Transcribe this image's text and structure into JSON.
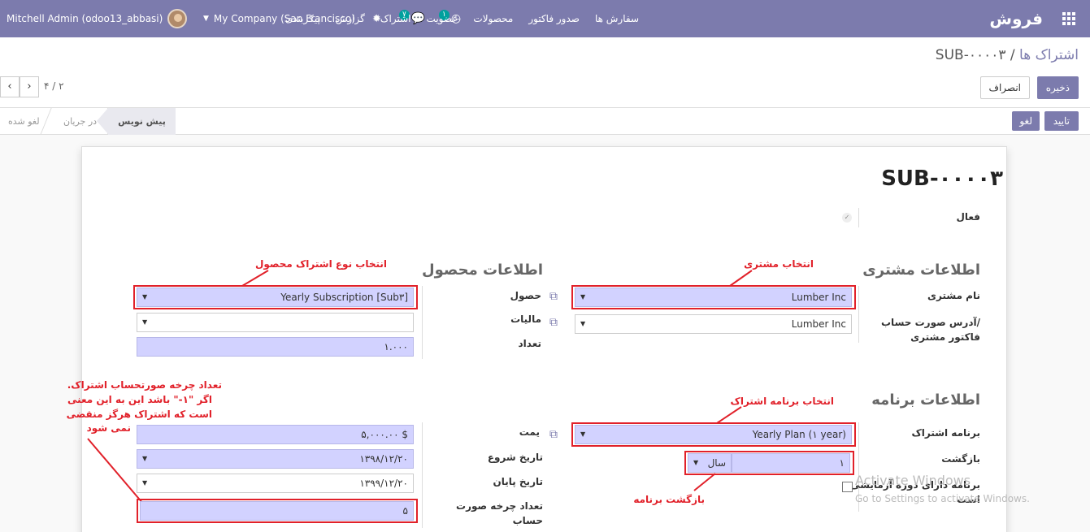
{
  "navbar": {
    "user": "Mitchell Admin (odoo13_abbasi)",
    "company": "My Company (San Francisco)",
    "chat_count": "۷",
    "activity_count": "۱",
    "brand": "فروش",
    "menu": [
      "سفارش ها",
      "صدور فاکتور",
      "محصولات",
      "عضویت",
      "اشتراک",
      "گزارش",
      "پیکربندی"
    ]
  },
  "breadcrumb": {
    "parent": "اشتراک ها",
    "separator": "/",
    "current": "SUB-۰۰۰۰۳"
  },
  "toolbar": {
    "save": "ذخیره",
    "discard": "انصراف"
  },
  "pager": {
    "text": "۴ / ۲",
    "prev": "‹",
    "next": "›"
  },
  "status": {
    "confirm": "تایید",
    "cancel": "لغو",
    "stages": {
      "draft": "پیش نویس",
      "in_progress": "در جریان",
      "cancelled": "لغو شده"
    }
  },
  "form": {
    "title": "SUB-۰۰۰۰۳",
    "active_label": "فعال",
    "customer_section": "اطلاعات مشتری",
    "customer_label": "نام مشتری",
    "customer_value": "Lumber Inc",
    "invoice_address_label_1": "آدرس صورت حساب/",
    "invoice_address_label_2": "فاکتور مشتری",
    "invoice_address_value": "Lumber Inc",
    "product_section": "اطلاعات محصول",
    "product_label": "حصول",
    "product_value": "[Sub۳] Yearly Subscription",
    "taxes_label": "مالیات",
    "quantity_label": "تعداد",
    "quantity_value": "۱.۰۰۰",
    "plan_section": "اطلاعات برنامه",
    "plan_label": "برنامه اشتراک",
    "plan_value": "Yearly Plan (۱ year)",
    "recurrence_label": "بازگشت",
    "recurrence_value": "۱",
    "recurrence_unit": "سال",
    "trial_label_1": "برنامه دارای دوره آزمایشی",
    "trial_label_2": "است",
    "price_label": "یمت",
    "price_value": "$ ۵,۰۰۰.۰۰",
    "start_label": "تاریخ شروع",
    "start_value": "۱۳۹۸/۱۲/۲۰",
    "end_label": "تاریخ پایان",
    "end_value": "۱۳۹۹/۱۲/۲۰",
    "cycles_label_1": "تعداد چرخه صورت",
    "cycles_label_2": "حساب",
    "cycles_value": "۵"
  },
  "annotations": {
    "product_type": "انتخاب نوع اشتراک محصول",
    "customer": "انتخاب مشتری",
    "plan": "انتخاب برنامه اشتراک",
    "recurrence": "بازگشت برنامه",
    "cycles_1": "تعداد چرخه صورتحساب اشتراک.",
    "cycles_2": "اگر \"۱-\" باشد این به این معنی",
    "cycles_3": "است که اشتراک هرگز منقضی",
    "cycles_4": "نمی شود"
  },
  "watermark": {
    "line1": "Activate Windows",
    "line2": "Go to Settings to activate Windows."
  },
  "colors": {
    "primary": "#7c7bad",
    "required_field": "#d2d2ff",
    "annotation": "#e1212a"
  }
}
